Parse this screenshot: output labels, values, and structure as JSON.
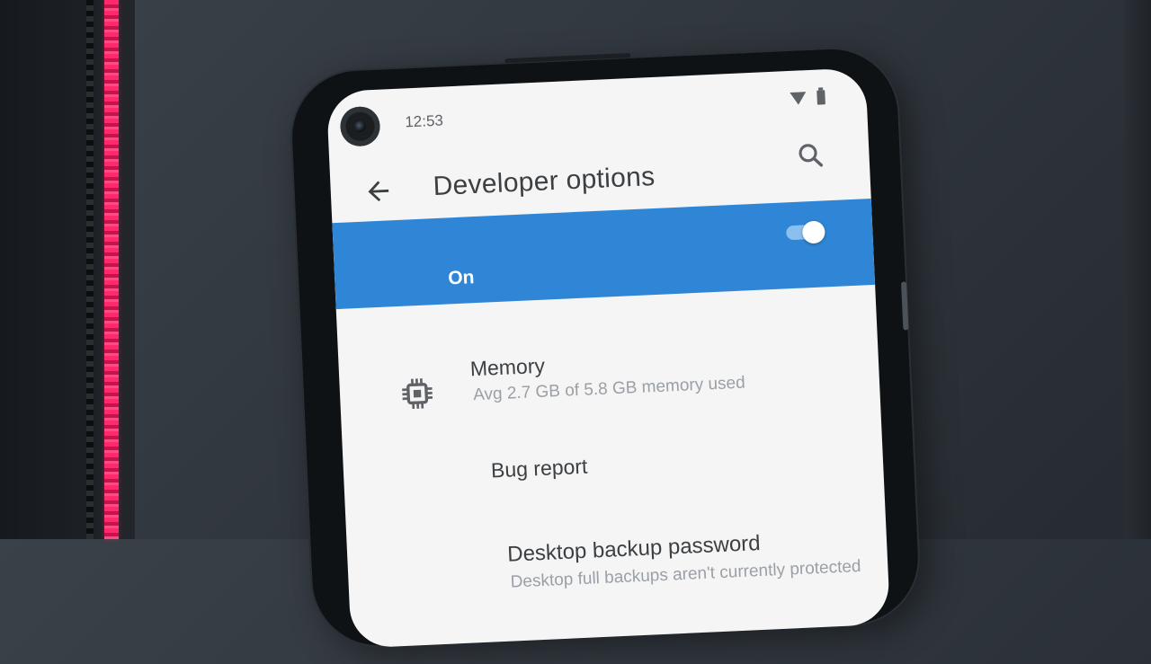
{
  "status_bar": {
    "time": "12:53",
    "icons": [
      "wifi-icon",
      "battery-icon"
    ]
  },
  "app_bar": {
    "title": "Developer options",
    "back_icon": "arrow-back-icon",
    "search_icon": "search-icon"
  },
  "main_toggle": {
    "label": "On",
    "state": "on",
    "accent_color": "#2f86d6"
  },
  "settings": [
    {
      "title": "Memory",
      "summary": "Avg 2.7 GB of 5.8 GB memory used",
      "icon": "memory-chip-icon"
    },
    {
      "title": "Bug report"
    },
    {
      "title": "Desktop backup password",
      "summary": "Desktop full backups aren't currently protected"
    }
  ]
}
